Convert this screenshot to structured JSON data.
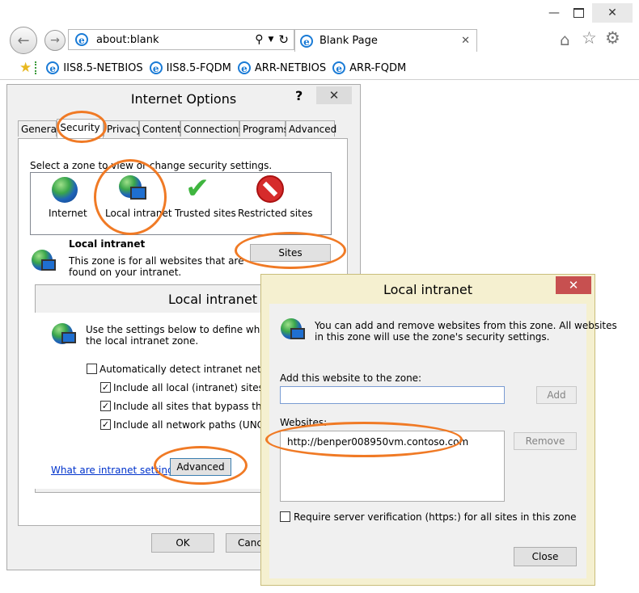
{
  "browser": {
    "address": "about:blank",
    "tab_title": "Blank Page",
    "favorites": [
      "IIS8.5-NETBIOS",
      "IIS8.5-FQDM",
      "ARR-NETBIOS",
      "ARR-FQDM"
    ]
  },
  "internet_options": {
    "title": "Internet Options",
    "help": "?",
    "tabs": [
      "General",
      "Security",
      "Privacy",
      "Content",
      "Connections",
      "Programs",
      "Advanced"
    ],
    "select_zone_text": "Select a zone to view or change security settings.",
    "zones": [
      "Internet",
      "Local intranet",
      "Trusted sites",
      "Restricted sites"
    ],
    "zone_heading": "Local intranet",
    "zone_desc_1": "This zone is for all websites that are",
    "zone_desc_2": "found on your intranet.",
    "sites_button": "Sites",
    "ok_button": "OK",
    "cancel_button": "Cance"
  },
  "local_intranet_settings": {
    "title": "Local intranet",
    "desc_1": "Use the settings below to define which we",
    "desc_2": "the local intranet zone.",
    "options": [
      {
        "label": "Automatically detect intranet network",
        "checked": false
      },
      {
        "label": "Include all local (intranet) sites not l",
        "checked": true
      },
      {
        "label": "Include all sites that bypass the prox",
        "checked": true
      },
      {
        "label": "Include all network paths (UNCs)",
        "checked": true
      }
    ],
    "link": "What are intranet settings?",
    "advanced_button": "Advanced"
  },
  "local_intranet_sites": {
    "title": "Local intranet",
    "desc_1": "You can add and remove websites from this zone. All websites",
    "desc_2": "in this zone will use the zone's security settings.",
    "add_label": "Add this website to the zone:",
    "add_value": "",
    "add_button": "Add",
    "websites_label": "Websites:",
    "websites": [
      "http://benper008950vm.contoso.com"
    ],
    "remove_button": "Remove",
    "require_https_label": "Require server verification (https:) for all sites in this zone",
    "require_https_checked": false,
    "close_button": "Close"
  },
  "colors": {
    "accent_orange": "#f07a25",
    "close_red": "#c75050"
  }
}
